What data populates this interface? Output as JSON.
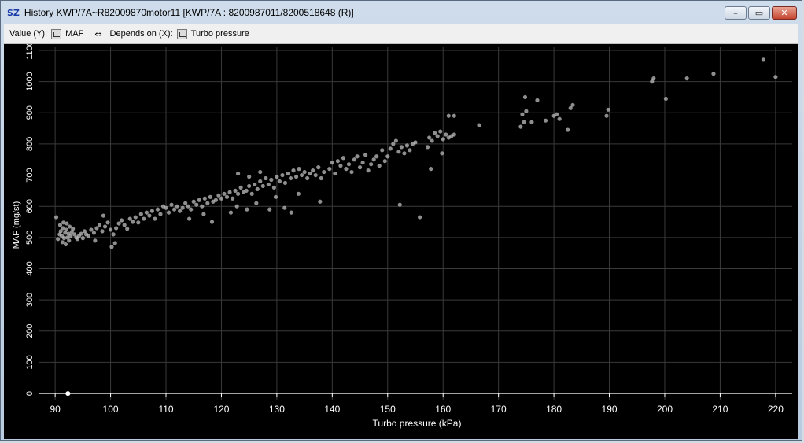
{
  "window": {
    "app_icon": "SZ",
    "title": "History KWP/7A~R82009870motor11 [KWP/7A : 8200987011/8200518648 (R)]",
    "controls": [
      {
        "name": "minimize-icon",
        "glyph": "–"
      },
      {
        "name": "maximize-icon",
        "glyph": "▭"
      },
      {
        "name": "close-icon",
        "glyph": "✕"
      }
    ]
  },
  "toolbar": {
    "value_label": "Value (Y):",
    "value_param": "MAF",
    "link_glyph": "⇔",
    "depends_label": "Depends on (X):",
    "depends_param": "Turbo pressure"
  },
  "colors": {
    "plot_background": "#000000",
    "grid": "#3a3a3a",
    "axis_text": "#ffffff",
    "points": "#bdbdbd"
  },
  "chart_data": {
    "type": "scatter",
    "xlabel": "Turbo pressure (kPa)",
    "ylabel": "MAF (mg/st)",
    "xlim": [
      87,
      223
    ],
    "ylim": [
      -20,
      1110
    ],
    "xticks": [
      90,
      100,
      110,
      120,
      130,
      140,
      150,
      160,
      170,
      180,
      190,
      200,
      210,
      220
    ],
    "yticks": [
      0,
      100,
      200,
      300,
      400,
      500,
      600,
      700,
      800,
      900,
      1000,
      1100
    ],
    "grid": true,
    "legend": "none",
    "points": [
      [
        90.2,
        565
      ],
      [
        90.5,
        495
      ],
      [
        90.8,
        510
      ],
      [
        91.0,
        520
      ],
      [
        91.2,
        505
      ],
      [
        91.4,
        530
      ],
      [
        91.6,
        498
      ],
      [
        91.8,
        515
      ],
      [
        92.0,
        525
      ],
      [
        92.2,
        500
      ],
      [
        92.4,
        512
      ],
      [
        92.6,
        535
      ],
      [
        92.8,
        505
      ],
      [
        93.0,
        518
      ],
      [
        93.2,
        528
      ],
      [
        91.3,
        485
      ],
      [
        91.9,
        478
      ],
      [
        92.5,
        490
      ],
      [
        93.5,
        510
      ],
      [
        90.9,
        540
      ],
      [
        91.5,
        548
      ],
      [
        92.1,
        545
      ],
      [
        93.8,
        500
      ],
      [
        94.0,
        495
      ],
      [
        94.3,
        505
      ],
      [
        94.7,
        512
      ],
      [
        95.0,
        498
      ],
      [
        95.3,
        520
      ],
      [
        95.6,
        510
      ],
      [
        96.0,
        505
      ],
      [
        96.5,
        525
      ],
      [
        97.0,
        515
      ],
      [
        97.5,
        530
      ],
      [
        98.0,
        540
      ],
      [
        98.5,
        520
      ],
      [
        99.0,
        535
      ],
      [
        99.5,
        548
      ],
      [
        100.0,
        525
      ],
      [
        100.5,
        510
      ],
      [
        101.0,
        530
      ],
      [
        101.5,
        545
      ],
      [
        102.0,
        555
      ],
      [
        102.5,
        540
      ],
      [
        103.0,
        528
      ],
      [
        103.5,
        560
      ],
      [
        104.0,
        550
      ],
      [
        104.5,
        565
      ],
      [
        105.0,
        548
      ],
      [
        105.5,
        575
      ],
      [
        106.0,
        560
      ],
      [
        106.5,
        580
      ],
      [
        107.0,
        570
      ],
      [
        107.5,
        585
      ],
      [
        108.0,
        560
      ],
      [
        108.5,
        590
      ],
      [
        109.0,
        575
      ],
      [
        109.5,
        600
      ],
      [
        100.2,
        470
      ],
      [
        100.8,
        482
      ],
      [
        98.7,
        570
      ],
      [
        97.2,
        490
      ],
      [
        110.0,
        595
      ],
      [
        110.5,
        580
      ],
      [
        111.0,
        605
      ],
      [
        111.5,
        590
      ],
      [
        112.0,
        600
      ],
      [
        112.5,
        585
      ],
      [
        113.0,
        595
      ],
      [
        113.5,
        610
      ],
      [
        114.0,
        600
      ],
      [
        114.5,
        590
      ],
      [
        115.0,
        615
      ],
      [
        115.5,
        605
      ],
      [
        116.0,
        620
      ],
      [
        116.5,
        600
      ],
      [
        117.0,
        625
      ],
      [
        117.5,
        610
      ],
      [
        118.0,
        630
      ],
      [
        118.5,
        615
      ],
      [
        119.0,
        620
      ],
      [
        119.5,
        635
      ],
      [
        120.0,
        625
      ],
      [
        120.5,
        640
      ],
      [
        121.0,
        630
      ],
      [
        121.5,
        645
      ],
      [
        122.0,
        625
      ],
      [
        122.5,
        650
      ],
      [
        123.0,
        640
      ],
      [
        123.5,
        660
      ],
      [
        124.0,
        645
      ],
      [
        124.5,
        650
      ],
      [
        125.0,
        665
      ],
      [
        125.5,
        640
      ],
      [
        126.0,
        670
      ],
      [
        126.5,
        655
      ],
      [
        127.0,
        680
      ],
      [
        127.5,
        665
      ],
      [
        128.0,
        690
      ],
      [
        128.5,
        670
      ],
      [
        129.0,
        685
      ],
      [
        129.5,
        660
      ],
      [
        130.0,
        695
      ],
      [
        130.5,
        680
      ],
      [
        131.0,
        700
      ],
      [
        131.5,
        675
      ],
      [
        132.0,
        705
      ],
      [
        132.5,
        690
      ],
      [
        133.0,
        715
      ],
      [
        133.5,
        695
      ],
      [
        134.0,
        720
      ],
      [
        134.5,
        700
      ],
      [
        135.0,
        710
      ],
      [
        135.5,
        690
      ],
      [
        136.0,
        705
      ],
      [
        136.5,
        715
      ],
      [
        137.0,
        700
      ],
      [
        137.5,
        725
      ],
      [
        138.0,
        690
      ],
      [
        138.5,
        710
      ],
      [
        114.2,
        560
      ],
      [
        116.8,
        575
      ],
      [
        118.3,
        550
      ],
      [
        121.7,
        580
      ],
      [
        122.8,
        600
      ],
      [
        124.6,
        590
      ],
      [
        126.3,
        610
      ],
      [
        128.7,
        590
      ],
      [
        129.8,
        630
      ],
      [
        131.4,
        595
      ],
      [
        132.6,
        580
      ],
      [
        133.9,
        640
      ],
      [
        137.8,
        615
      ],
      [
        123.0,
        705
      ],
      [
        125.0,
        695
      ],
      [
        127.0,
        710
      ],
      [
        139.5,
        720
      ],
      [
        140.0,
        740
      ],
      [
        140.5,
        705
      ],
      [
        141.0,
        745
      ],
      [
        141.5,
        730
      ],
      [
        142.0,
        755
      ],
      [
        142.5,
        720
      ],
      [
        143.0,
        735
      ],
      [
        143.5,
        710
      ],
      [
        144.0,
        750
      ],
      [
        144.5,
        760
      ],
      [
        145.0,
        725
      ],
      [
        145.5,
        740
      ],
      [
        146.0,
        765
      ],
      [
        146.5,
        715
      ],
      [
        147.0,
        735
      ],
      [
        147.5,
        750
      ],
      [
        148.0,
        760
      ],
      [
        148.5,
        730
      ],
      [
        149.0,
        780
      ],
      [
        149.5,
        745
      ],
      [
        150.0,
        760
      ],
      [
        150.5,
        785
      ],
      [
        151.0,
        800
      ],
      [
        151.5,
        810
      ],
      [
        152.0,
        775
      ],
      [
        152.5,
        790
      ],
      [
        153.0,
        770
      ],
      [
        153.5,
        795
      ],
      [
        154.0,
        780
      ],
      [
        154.5,
        800
      ],
      [
        155.0,
        805
      ],
      [
        152.2,
        605
      ],
      [
        155.8,
        565
      ],
      [
        157.5,
        820
      ],
      [
        158.0,
        810
      ],
      [
        158.5,
        835
      ],
      [
        159.0,
        825
      ],
      [
        159.5,
        840
      ],
      [
        160.0,
        815
      ],
      [
        160.5,
        830
      ],
      [
        161.0,
        820
      ],
      [
        161.5,
        825
      ],
      [
        162.0,
        830
      ],
      [
        157.2,
        790
      ],
      [
        157.8,
        720
      ],
      [
        159.8,
        770
      ],
      [
        161.0,
        890
      ],
      [
        162.0,
        890
      ],
      [
        166.5,
        860
      ],
      [
        174.0,
        855
      ],
      [
        174.3,
        895
      ],
      [
        174.6,
        870
      ],
      [
        175.0,
        905
      ],
      [
        174.8,
        950
      ],
      [
        176.0,
        870
      ],
      [
        177.0,
        940
      ],
      [
        178.5,
        875
      ],
      [
        180.0,
        890
      ],
      [
        180.5,
        895
      ],
      [
        181.0,
        880
      ],
      [
        182.5,
        845
      ],
      [
        183.0,
        915
      ],
      [
        183.4,
        925
      ],
      [
        189.5,
        890
      ],
      [
        189.8,
        910
      ],
      [
        197.7,
        1000
      ],
      [
        198.0,
        1010
      ],
      [
        200.2,
        945
      ],
      [
        204.0,
        1010
      ],
      [
        208.8,
        1025
      ],
      [
        217.8,
        1070
      ],
      [
        220.0,
        1015
      ],
      [
        92.3,
        0
      ]
    ]
  }
}
